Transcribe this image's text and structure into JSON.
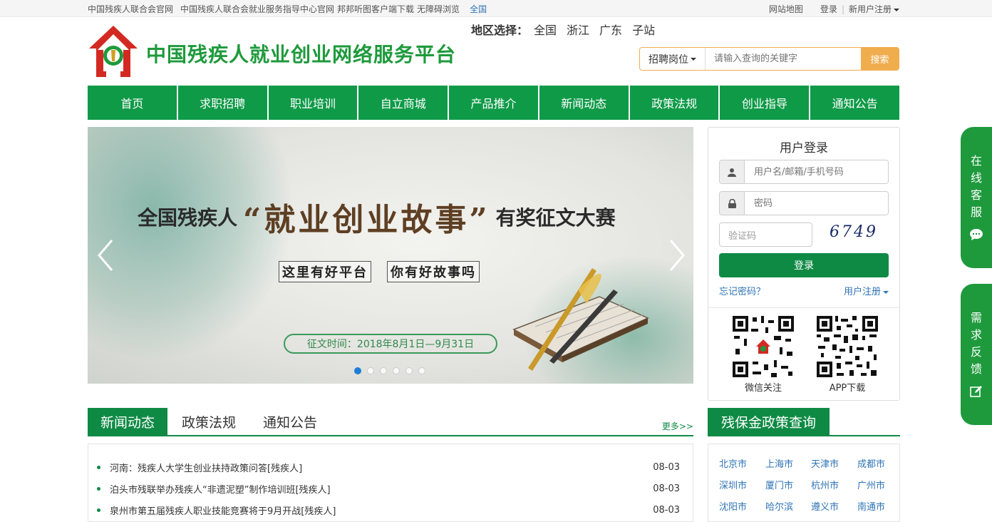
{
  "topbar": {
    "links": [
      "中国残疾人联合会官网",
      "中国残疾人联合会就业服务指导中心官网",
      "邦邦听图客户端下载",
      "无障碍浏览"
    ],
    "region_current": "全国",
    "sitemap": "网站地图",
    "login": "登录",
    "register": "新用户注册"
  },
  "header": {
    "title": "中国残疾人就业创业网络服务平台",
    "region_label": "地区选择：",
    "regions": [
      "全国",
      "浙江",
      "广东",
      "子站"
    ],
    "search_type": "招聘岗位",
    "search_placeholder": "请输入查询的关键字",
    "search_button": "搜索"
  },
  "nav": [
    "首页",
    "求职招聘",
    "职业培训",
    "自立商城",
    "产品推介",
    "新闻动态",
    "政策法规",
    "创业指导",
    "通知公告"
  ],
  "banner": {
    "headline_prefix": "全国残疾人",
    "headline_quote": "“就业创业故事”",
    "headline_suffix": "有奖征文大赛",
    "sub1": "这里有好平台",
    "sub2": "你有好故事吗",
    "date": "征文时间：2018年8月1日—9月31日",
    "slides": 6,
    "active_slide": 1
  },
  "login": {
    "title": "用户登录",
    "username_placeholder": "用户名/邮箱/手机号码",
    "password_placeholder": "密码",
    "captcha_placeholder": "验证码",
    "captcha_code": "6749",
    "button": "登录",
    "forgot": "忘记密码？",
    "register": "用户注册",
    "qr_wechat": "微信关注",
    "qr_app": "APP下载"
  },
  "news": {
    "tabs": [
      "新闻动态",
      "政策法规",
      "通知公告"
    ],
    "more": "更多>>",
    "items": [
      {
        "title": "河南：残疾人大学生创业扶持政策问答[残疾人]",
        "date": "08-03"
      },
      {
        "title": "泊头市残联举办残疾人“非遗泥塑”制作培训班[残疾人]",
        "date": "08-03"
      },
      {
        "title": "泉州市第五届残疾人职业技能竞赛将于9月开战[残疾人]",
        "date": "08-03"
      }
    ]
  },
  "policy": {
    "title": "残保金政策查询",
    "cities": [
      "北京市",
      "上海市",
      "天津市",
      "成都市",
      "深圳市",
      "厦门市",
      "杭州市",
      "广州市",
      "沈阳市",
      "哈尔滨",
      "遵义市",
      "南通市"
    ]
  },
  "float": {
    "service": [
      "在",
      "线",
      "客",
      "服"
    ],
    "feedback": [
      "需",
      "求",
      "反",
      "馈"
    ]
  }
}
